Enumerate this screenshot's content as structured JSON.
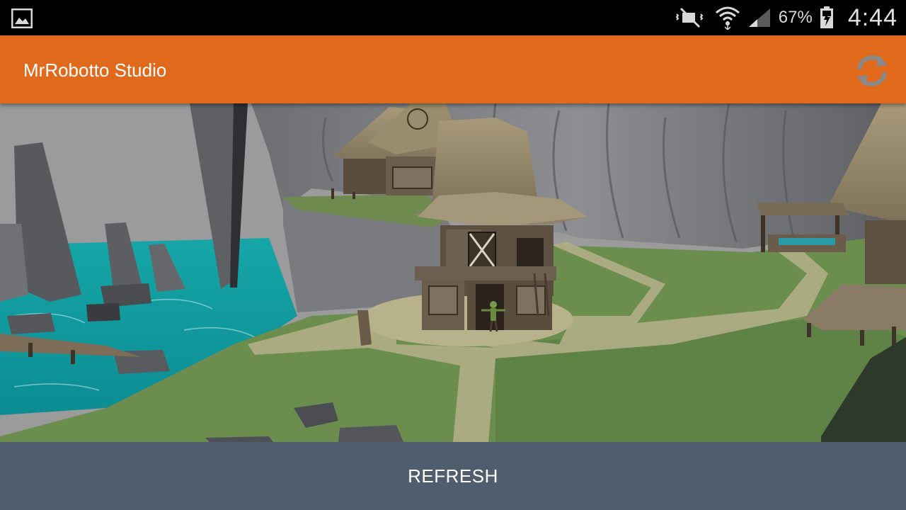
{
  "status_bar": {
    "battery_percent": "67%",
    "time": "4:44",
    "icons": [
      "gallery-icon",
      "mute-icon",
      "wifi-icon",
      "signal-icon",
      "battery-charging-icon"
    ]
  },
  "action_bar": {
    "title": "MrRobotto Studio",
    "refresh_icon": "sync-icon"
  },
  "scene": {
    "description_icon": "3d-scene"
  },
  "bottom": {
    "refresh_label": "REFRESH"
  },
  "colors": {
    "action_bar": "#e0691b",
    "bottom_bar": "#4f5d6e",
    "status_bar": "#000000"
  }
}
